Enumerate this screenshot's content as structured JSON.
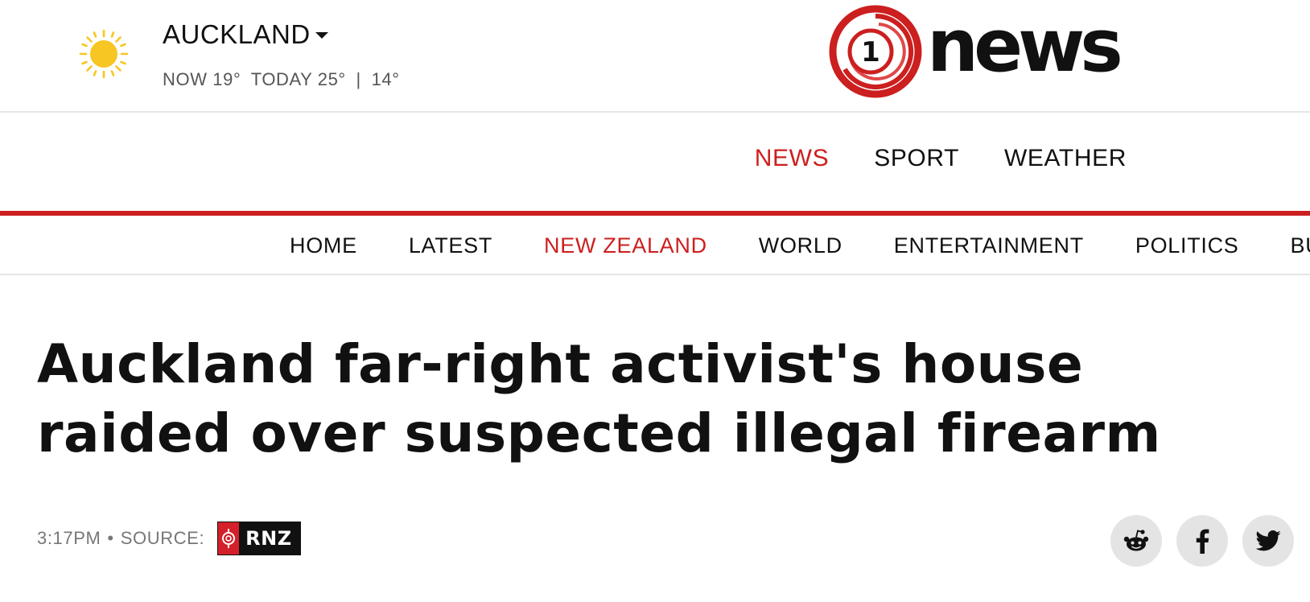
{
  "weather": {
    "icon": "sun-icon",
    "location": "AUCKLAND",
    "now": "NOW 19°",
    "today": "TODAY 25°",
    "divider": "|",
    "low": "14°"
  },
  "logo": {
    "numeral": "1",
    "word": "news",
    "brand_color": "#cc1f1f"
  },
  "section_nav": [
    {
      "label": "NEWS",
      "active": true
    },
    {
      "label": "SPORT",
      "active": false
    },
    {
      "label": "WEATHER",
      "active": false
    }
  ],
  "category_nav": [
    {
      "label": "HOME"
    },
    {
      "label": "LATEST"
    },
    {
      "label": "NEW ZEALAND",
      "active": true
    },
    {
      "label": "WORLD"
    },
    {
      "label": "ENTERTAINMENT"
    },
    {
      "label": "POLITICS"
    },
    {
      "label": "BUSIN"
    }
  ],
  "article": {
    "headline": "Auckland far-right activist's house raided over suspected illegal firearm",
    "time": "3:17PM",
    "separator": "•",
    "source_label": "SOURCE:",
    "source_name": "RNZ"
  },
  "share": [
    {
      "name": "reddit-icon"
    },
    {
      "name": "facebook-icon"
    },
    {
      "name": "twitter-icon"
    }
  ],
  "colors": {
    "accent": "#cc1f1f",
    "rule": "#e6e6e6",
    "share_bg": "#e4e4e4",
    "sun": "#f7c623"
  }
}
